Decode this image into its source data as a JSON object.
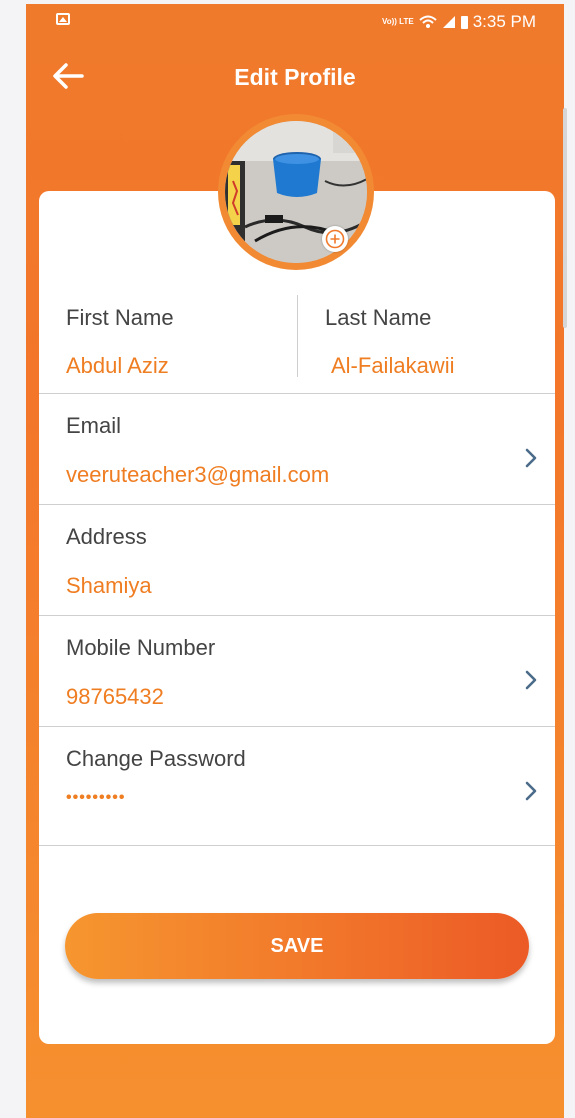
{
  "status_bar": {
    "network_label": "Vo)) LTE",
    "time": "3:35 PM",
    "icons": [
      "gallery-notification-icon",
      "volte-icon",
      "wifi-icon",
      "signal-icon",
      "battery-icon"
    ]
  },
  "header": {
    "title": "Edit Profile",
    "back_icon": "arrow-left-icon"
  },
  "profile_photo": {
    "add_icon": "plus-circle-icon"
  },
  "form": {
    "first_name": {
      "label": "First Name",
      "value": "Abdul Aziz"
    },
    "last_name": {
      "label": "Last Name",
      "value": "Al-Failakawii"
    },
    "email": {
      "label": "Email",
      "value": "veeruteacher3@gmail.com"
    },
    "address": {
      "label": "Address",
      "value": "Shamiya"
    },
    "mobile": {
      "label": "Mobile Number",
      "value": "98765432"
    },
    "password": {
      "label": "Change Password",
      "value": "•••••••••"
    }
  },
  "actions": {
    "save_label": "SAVE"
  },
  "colors": {
    "accent": "#F27A2B",
    "accent_text": "#EF7D22",
    "label_text": "#444444",
    "chevron": "#4a6b8a"
  }
}
